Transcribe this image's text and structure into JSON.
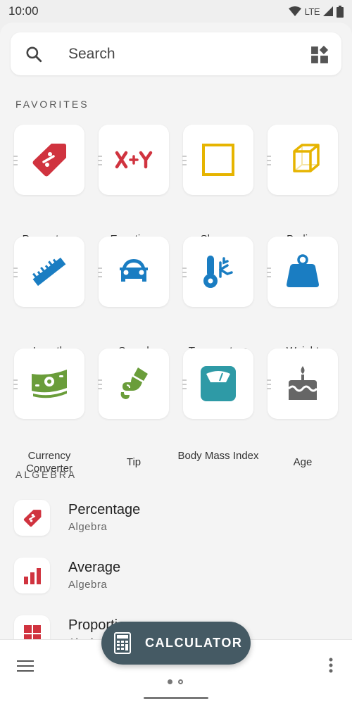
{
  "status_bar": {
    "time": "10:00",
    "network": "LTE"
  },
  "search": {
    "placeholder": "Search"
  },
  "favorites": {
    "title": "FAVORITES",
    "items": [
      {
        "label": "Percentage",
        "icon": "percent-tag-icon",
        "color": "#d0333f"
      },
      {
        "label": "Equations",
        "icon": "x-plus-y-icon",
        "color": "#d0333f"
      },
      {
        "label": "Shapes",
        "icon": "square-icon",
        "color": "#e6b400"
      },
      {
        "label": "Bodies",
        "icon": "cube-icon",
        "color": "#e6b400"
      },
      {
        "label": "Length",
        "icon": "ruler-icon",
        "color": "#1a7dc2"
      },
      {
        "label": "Speed",
        "icon": "car-icon",
        "color": "#1a7dc2"
      },
      {
        "label": "Temperature",
        "icon": "thermometer-icon",
        "color": "#1a7dc2"
      },
      {
        "label": "Weight",
        "icon": "weight-icon",
        "color": "#1a7dc2"
      },
      {
        "label": "Currency Converter",
        "icon": "money-icon",
        "color": "#6a9d3a"
      },
      {
        "label": "Tip",
        "icon": "hand-coin-icon",
        "color": "#6a9d3a"
      },
      {
        "label": "Body Mass Index",
        "icon": "scale-icon",
        "color": "#2e9aa6"
      },
      {
        "label": "Age",
        "icon": "birthday-cake-icon",
        "color": "#666666"
      }
    ]
  },
  "algebra": {
    "title": "ALGEBRA",
    "items": [
      {
        "title": "Percentage",
        "subtitle": "Algebra",
        "icon": "percent-tag-icon"
      },
      {
        "title": "Average",
        "subtitle": "Algebra",
        "icon": "bar-chart-icon"
      },
      {
        "title": "Proportion",
        "subtitle": "Algebra",
        "icon": "grid-icon"
      }
    ]
  },
  "fab": {
    "label": "CALCULATOR"
  },
  "colors": {
    "accent_red": "#d0333f",
    "fab_bg": "#455a64"
  }
}
